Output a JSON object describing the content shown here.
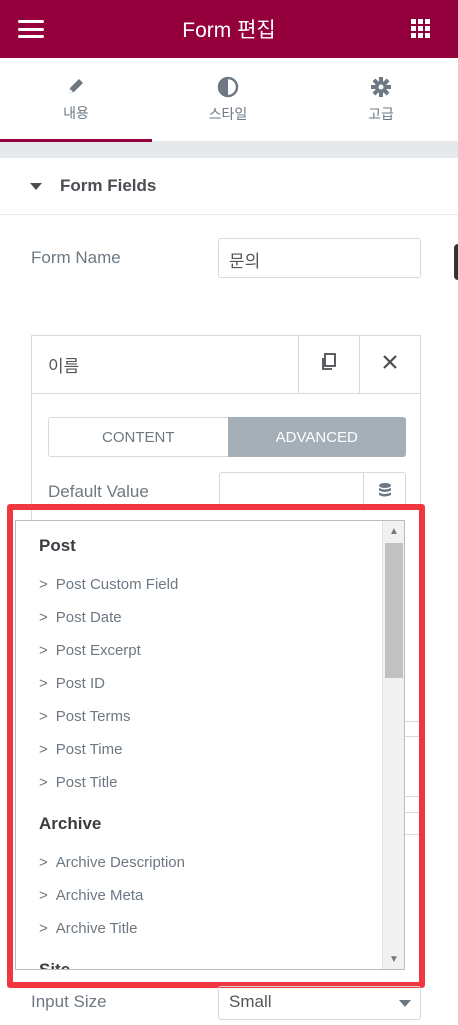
{
  "header": {
    "title": "Form 편집",
    "menu_icon": "hamburger-icon",
    "apps_icon": "grid-icon",
    "accent": "#93003c"
  },
  "tabs": [
    {
      "label": "내용",
      "icon": "pencil-icon",
      "active": true
    },
    {
      "label": "스타일",
      "icon": "contrast-icon",
      "active": false
    },
    {
      "label": "고급",
      "icon": "gear-icon",
      "active": false
    }
  ],
  "section": {
    "title": "Form Fields"
  },
  "form_name": {
    "label": "Form Name",
    "value": "문의"
  },
  "field": {
    "title": "이름",
    "duplicate_icon": "copy-icon",
    "remove_icon": "close-icon",
    "switch": {
      "content": "CONTENT",
      "advanced": "ADVANCED",
      "selected": "ADVANCED"
    },
    "default_value": {
      "label": "Default Value",
      "value": "",
      "dynamic_icon": "database-icon"
    }
  },
  "dynamic_tags": {
    "groups": [
      {
        "name": "Post",
        "items": [
          "Post Custom Field",
          "Post Date",
          "Post Excerpt",
          "Post ID",
          "Post Terms",
          "Post Time",
          "Post Title"
        ]
      },
      {
        "name": "Archive",
        "items": [
          "Archive Description",
          "Archive Meta",
          "Archive Title"
        ]
      },
      {
        "name": "Site",
        "items": []
      }
    ],
    "chevron": ">"
  },
  "input_size": {
    "label": "Input Size",
    "value": "Small"
  },
  "highlight_color": "#f0363f"
}
